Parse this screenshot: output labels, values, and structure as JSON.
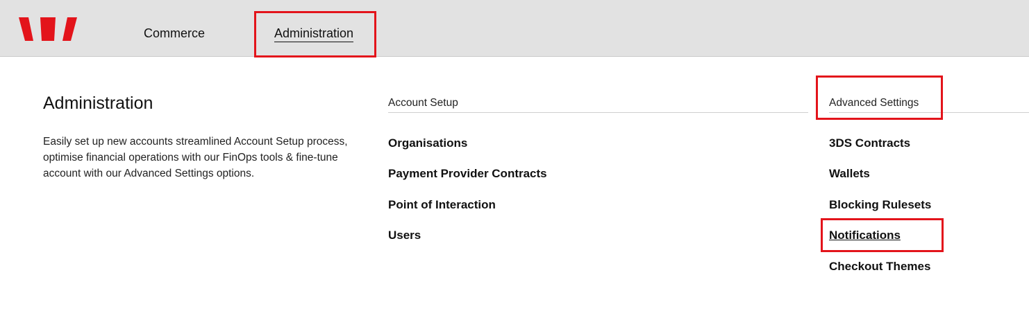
{
  "topbar": {
    "logo_icon": "westpac-w-logo-icon",
    "brand_color": "#e3141b",
    "background": "#e2e2e2",
    "nav": [
      {
        "label": "Commerce",
        "active": false
      },
      {
        "label": "Administration",
        "active": true
      }
    ]
  },
  "page": {
    "title": "Administration",
    "description": "Easily set up new accounts streamlined Account Setup process, optimise financial operations with our FinOps tools & fine-tune account with our Advanced Settings options."
  },
  "account_setup": {
    "heading": "Account Setup",
    "items": [
      {
        "label": "Organisations"
      },
      {
        "label": "Payment Provider Contracts"
      },
      {
        "label": "Point of Interaction"
      },
      {
        "label": "Users"
      }
    ]
  },
  "advanced_settings": {
    "heading": "Advanced Settings",
    "items": [
      {
        "label": "3DS Contracts"
      },
      {
        "label": "Wallets"
      },
      {
        "label": "Blocking Rulesets"
      },
      {
        "label": "Notifications",
        "hovered": true
      },
      {
        "label": "Checkout Themes"
      }
    ]
  },
  "highlight_color": "#e3141b"
}
